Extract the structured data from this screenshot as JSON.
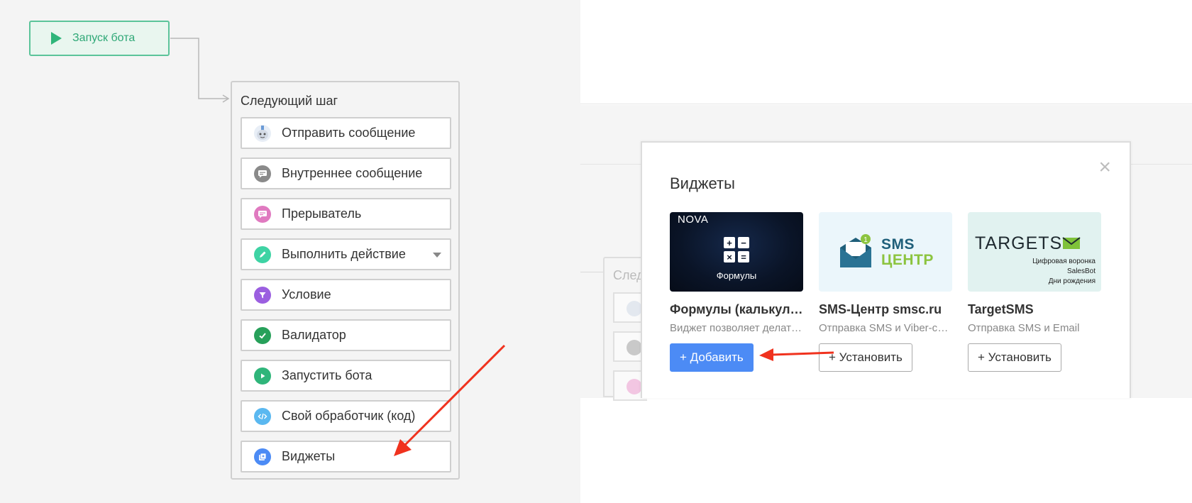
{
  "start_node": {
    "label": "Запуск бота",
    "icon": "play-icon"
  },
  "next_step": {
    "title": "Следующий шаг",
    "items": [
      {
        "label": "Отправить сообщение",
        "icon": "robot-icon",
        "color": "#dbe7f5"
      },
      {
        "label": "Внутреннее сообщение",
        "icon": "chat-bubble-icon",
        "color": "#8a8a8a"
      },
      {
        "label": "Прерыватель",
        "icon": "chat-bubble-icon",
        "color": "#e07ac0"
      },
      {
        "label": "Выполнить действие",
        "icon": "pencil-icon",
        "color": "#3ed3a4"
      },
      {
        "label": "Условие",
        "icon": "filter-icon",
        "color": "#9b5fe0"
      },
      {
        "label": "Валидатор",
        "icon": "checkmark-icon",
        "color": "#27a05a"
      },
      {
        "label": "Запустить бота",
        "icon": "play-circle-icon",
        "color": "#2fb57a"
      },
      {
        "label": "Свой обработчик (код)",
        "icon": "code-icon",
        "color": "#5ab8f0"
      },
      {
        "label": "Виджеты",
        "icon": "widget-icon",
        "color": "#4c8bf5"
      }
    ]
  },
  "ghost": {
    "title": "След"
  },
  "modal": {
    "title": "Виджеты",
    "close": "×",
    "cards": [
      {
        "name": "Формулы (калькуля...",
        "desc": "Виджет позволяет делать...",
        "button": "+ Добавить",
        "thumb_brand": "NOVA",
        "thumb_caption": "Формулы"
      },
      {
        "name": "SMS-Центр smsc.ru",
        "desc": "Отправка SMS и Viber-со...",
        "button": "+ Установить",
        "thumb_word1": "SMS",
        "thumb_word2": "ЦЕНТР",
        "thumb_badge": "1"
      },
      {
        "name": "TargetSMS",
        "desc": "Отправка SMS и Email",
        "button": "+ Установить",
        "thumb_logo": "TARGETS",
        "thumb_lines": [
          "Цифровая воронка",
          "SalesBot",
          "Дни рождения"
        ]
      }
    ]
  },
  "colors": {
    "accent_green": "#2fb57a",
    "primary_blue": "#4c8bf5",
    "annotation_red": "#f0321e"
  }
}
